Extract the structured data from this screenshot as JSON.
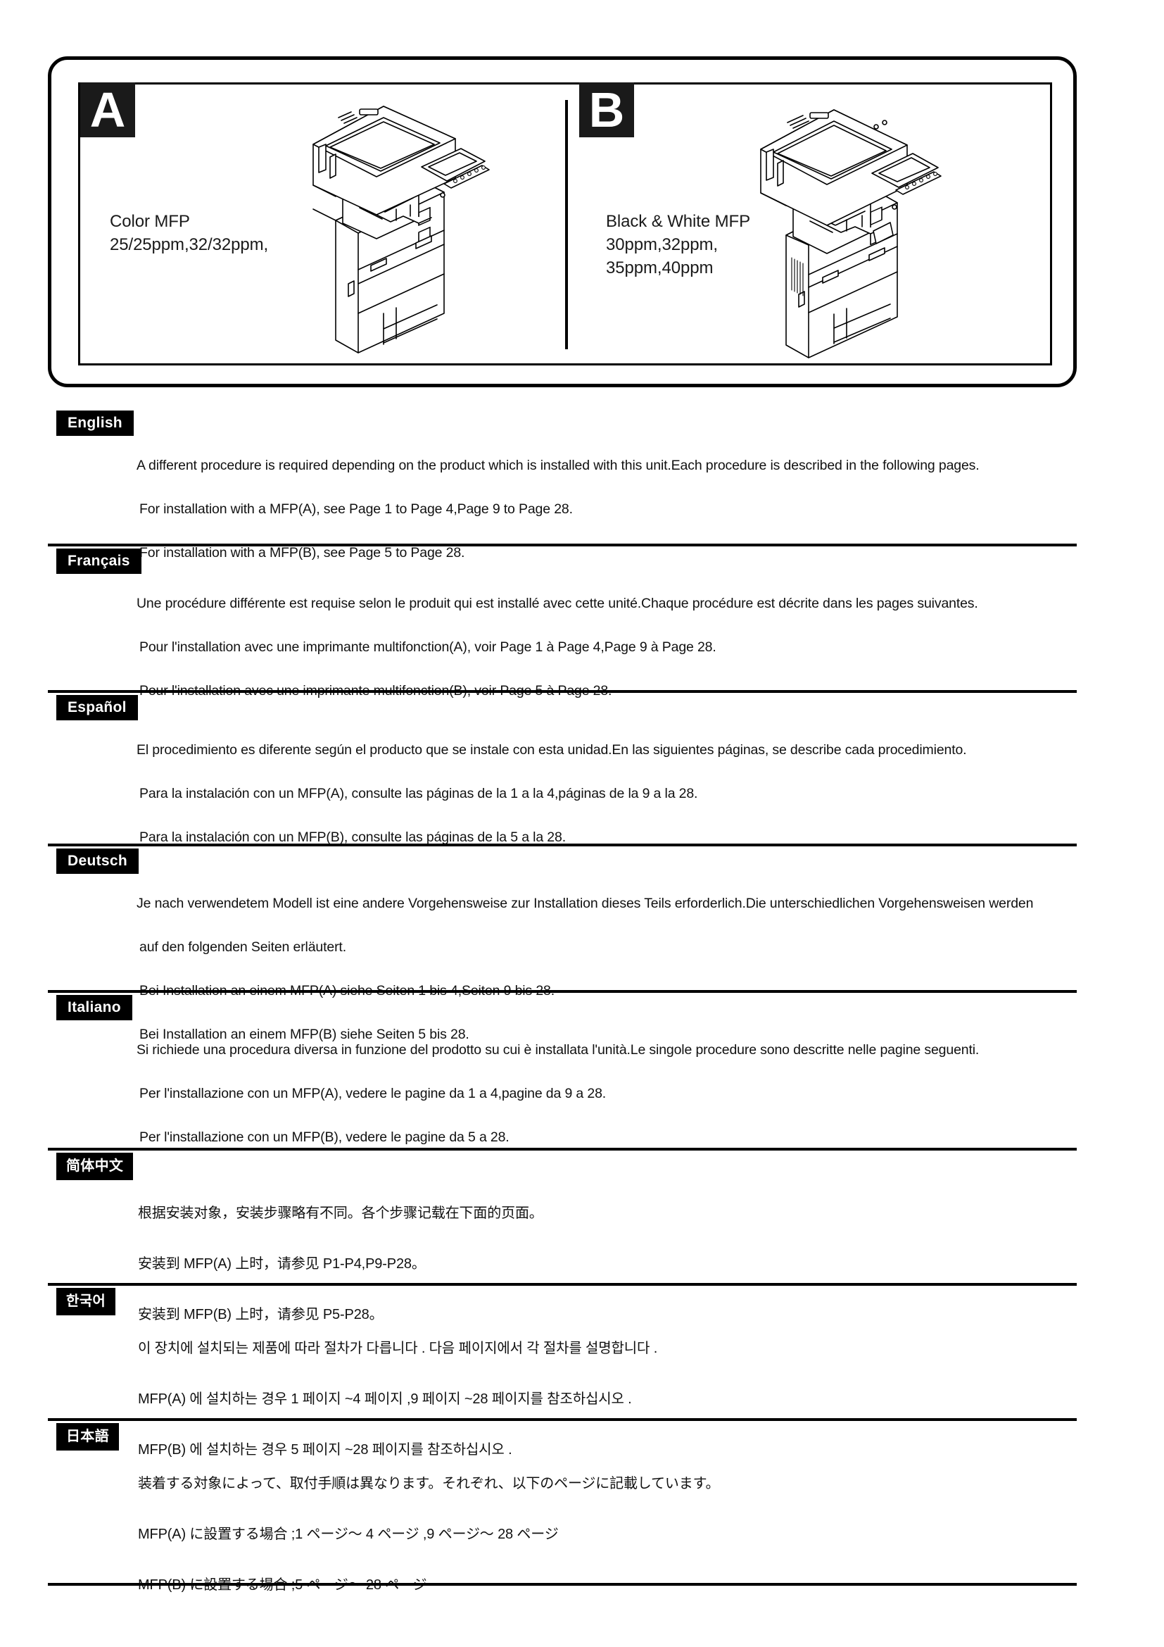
{
  "hero": {
    "panel_a": {
      "badge": "A",
      "caption": "Color MFP\n25/25ppm,32/32ppm,",
      "printer_art": "color-mfp-illustration"
    },
    "panel_b": {
      "badge": "B",
      "caption": "Black & White MFP\n30ppm,32ppm,\n35ppm,40ppm",
      "printer_art": "black-and-white-mfp-illustration"
    }
  },
  "colors": {
    "ink": "#000000",
    "tag_background": "#000000",
    "tag_text": "#ffffff",
    "page_background": "#ffffff"
  },
  "languages": [
    {
      "tag": "English",
      "line1": "A different procedure is required depending on the product which is installed with this unit.Each procedure is described in the following pages.",
      "line2": "For installation with a MFP(A), see Page 1 to Page 4,Page 9 to Page 28.",
      "line3": "For installation with a MFP(B), see Page 5 to Page 28.",
      "line4": ""
    },
    {
      "tag": "Français",
      "line1": "Une procédure différente est requise selon le produit qui est installé avec cette unité.Chaque procédure est décrite dans les pages suivantes.",
      "line2": "Pour l'installation avec une imprimante multifonction(A), voir Page 1 à Page 4,Page 9 à Page 28.",
      "line3": "Pour l'installation avec une imprimante multifonction(B), voir Page 5 à Page 28.",
      "line4": ""
    },
    {
      "tag": "Español",
      "line1": "El procedimiento es diferente según el producto que se instale con esta unidad.En las siguientes páginas, se describe cada procedimiento.",
      "line2": "Para la instalación con un MFP(A), consulte las páginas de la 1 a la 4,páginas de la 9 a la 28.",
      "line3": "Para la instalación con un MFP(B), consulte las páginas de la 5 a la 28.",
      "line4": ""
    },
    {
      "tag": "Deutsch",
      "line1": "Je nach verwendetem Modell ist eine andere Vorgehensweise zur Installation dieses Teils erforderlich.Die unterschiedlichen Vorgehensweisen werden",
      "line2": "auf den folgenden Seiten erläutert.",
      "line3": "Bei Installation an einem MFP(A) siehe Seiten 1 bis 4,Seiten 9 bis 28.",
      "line4": "Bei Installation an einem MFP(B) siehe Seiten 5 bis 28."
    },
    {
      "tag": "Italiano",
      "line1": "Si richiede una procedura diversa in funzione del prodotto su cui è installata l'unità.Le singole procedure sono descritte nelle pagine seguenti.",
      "line2": "Per l'installazione con un MFP(A), vedere le pagine da 1 a 4,pagine da 9 a 28.",
      "line3": "Per l'installazione con un MFP(B), vedere le pagine da 5 a 28.",
      "line4": ""
    },
    {
      "tag": "简体中文",
      "line1": "根据安装对象，安装步骤略有不同。各个步骤记载在下面的页面。",
      "line2": "安装到 MFP(A) 上时，请参见 P1-P4,P9-P28。",
      "line3": "安装到 MFP(B) 上时，请参见 P5-P28。",
      "line4": ""
    },
    {
      "tag": "한국어",
      "line1": "이 장치에 설치되는 제품에 따라 절차가 다릅니다 . 다음 페이지에서 각 절차를 설명합니다 .",
      "line2": "MFP(A) 에 설치하는 경우 1 페이지 ~4 페이지 ,9 페이지 ~28 페이지를 참조하십시오 .",
      "line3": "MFP(B) 에 설치하는 경우 5 페이지 ~28 페이지를 참조하십시오 .",
      "line4": ""
    },
    {
      "tag": "日本語",
      "line1": "装着する対象によって、取付手順は異なります。それぞれ、以下のページに記載しています。",
      "line2": "MFP(A) に設置する場合 ;1 ページ～ 4 ページ ,9 ページ～ 28 ページ",
      "line3": "MFP(B) に設置する場合 ;5 ページ～ 28 ページ",
      "line4": ""
    }
  ]
}
